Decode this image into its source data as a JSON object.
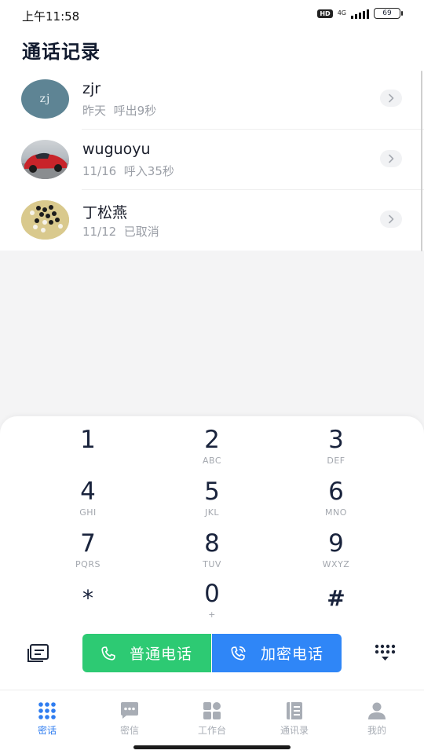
{
  "status_bar": {
    "time": "上午11:58",
    "hd": "HD",
    "network": "4G",
    "battery": "69"
  },
  "header": {
    "title": "通话记录"
  },
  "call_log": [
    {
      "name": "zjr",
      "avatar_text": "zj",
      "date": "昨天",
      "detail": "呼出9秒"
    },
    {
      "name": "wuguoyu",
      "date": "11/16",
      "detail": "呼入35秒"
    },
    {
      "name": "丁松燕",
      "date": "11/12",
      "detail": "已取消"
    }
  ],
  "dialpad": {
    "keys": [
      {
        "digit": "1",
        "letters": ""
      },
      {
        "digit": "2",
        "letters": "ABC"
      },
      {
        "digit": "3",
        "letters": "DEF"
      },
      {
        "digit": "4",
        "letters": "GHI"
      },
      {
        "digit": "5",
        "letters": "JKL"
      },
      {
        "digit": "6",
        "letters": "MNO"
      },
      {
        "digit": "7",
        "letters": "PQRS"
      },
      {
        "digit": "8",
        "letters": "TUV"
      },
      {
        "digit": "9",
        "letters": "WXYZ"
      },
      {
        "digit": "*",
        "letters": ""
      },
      {
        "digit": "0",
        "letters": "+"
      },
      {
        "digit": "#",
        "letters": ""
      }
    ],
    "normal_call_label": "普通电话",
    "secure_call_label": "加密电话"
  },
  "tabs": [
    {
      "label": "密话",
      "icon": "dots-grid-icon",
      "active": true
    },
    {
      "label": "密信",
      "icon": "chat-bubble-icon",
      "active": false
    },
    {
      "label": "工作台",
      "icon": "apps-grid-icon",
      "active": false
    },
    {
      "label": "通讯录",
      "icon": "address-book-icon",
      "active": false
    },
    {
      "label": "我的",
      "icon": "person-icon",
      "active": false
    }
  ],
  "colors": {
    "normal_call": "#2dca73",
    "secure_call": "#2f86f7",
    "active_tab": "#2f7df0",
    "inactive_tab": "#a8adb5"
  }
}
